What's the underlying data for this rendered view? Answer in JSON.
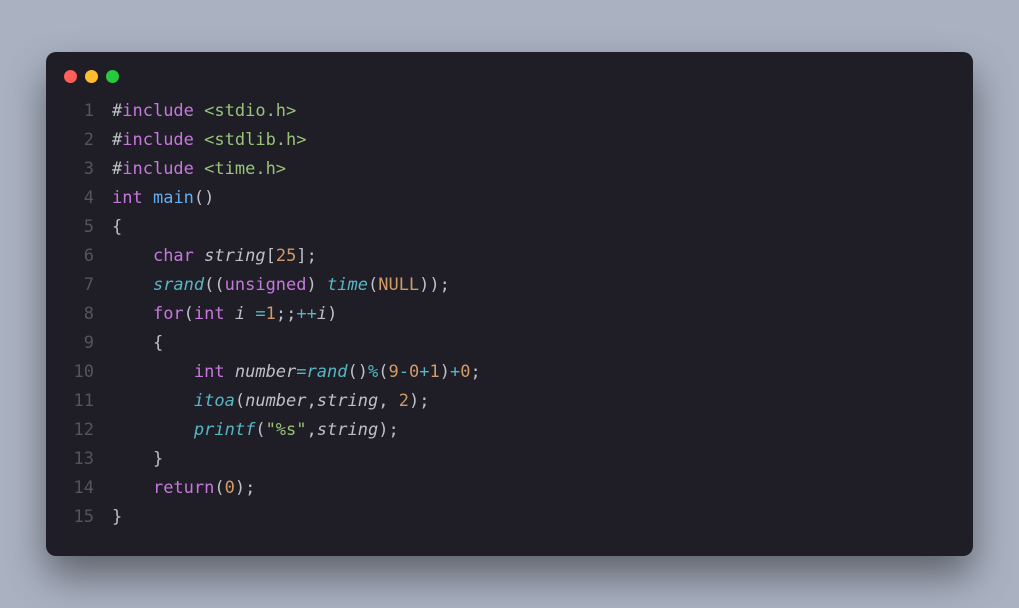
{
  "window": {
    "dots": [
      "red",
      "yellow",
      "green"
    ]
  },
  "code": {
    "gutter": [
      "1",
      "2",
      "3",
      "4",
      "5",
      "6",
      "7",
      "8",
      "9",
      "10",
      "11",
      "12",
      "13",
      "14",
      "15"
    ],
    "l1": {
      "hash": "#",
      "inc": "include",
      "path": "<stdio.h>"
    },
    "l2": {
      "hash": "#",
      "inc": "include",
      "path": "<stdlib.h>"
    },
    "l3": {
      "hash": "#",
      "inc": "include",
      "path": "<time.h>"
    },
    "l4": {
      "kw": "int",
      "sp": " ",
      "fn": "main",
      "par": "()"
    },
    "l5": {
      "brace": "{"
    },
    "l6": {
      "ind": "    ",
      "kw": "char",
      "sp": " ",
      "id": "string",
      "lb": "[",
      "n": "25",
      "rb": "]",
      "semi": ";"
    },
    "l7": {
      "ind": "    ",
      "fn": "srand",
      "lp": "((",
      "kw": "unsigned",
      "rp1": ")",
      "sp": " ",
      "fn2": "time",
      "lp2": "(",
      "null": "NULL",
      "rp2": "))",
      "semi": ";"
    },
    "l8": {
      "ind": "    ",
      "kw": "for",
      "lp": "(",
      "kw2": "int",
      "sp": " ",
      "id": "i",
      "sp2": " ",
      "eq": "=",
      "n": "1",
      "sc": ";;",
      "op": "++",
      "id2": "i",
      "rp": ")"
    },
    "l9": {
      "ind": "    ",
      "brace": "{"
    },
    "l10": {
      "ind": "        ",
      "kw": "int",
      "sp": " ",
      "id": "number",
      "eq": "=",
      "fn": "rand",
      "par": "()",
      "op1": "%",
      "lp": "(",
      "n9": "9",
      "m1": "-",
      "n0": "0",
      "p1": "+",
      "n1": "1",
      "rp": ")",
      "p2": "+",
      "n0b": "0",
      "semi": ";"
    },
    "l11": {
      "ind": "        ",
      "fn": "itoa",
      "lp": "(",
      "a1": "number",
      "c1": ",",
      "a2": "string",
      "c2": ",",
      "sp": " ",
      "n": "2",
      "rp": ")",
      "semi": ";"
    },
    "l12": {
      "ind": "        ",
      "fn": "printf",
      "lp": "(",
      "str": "\"%s\"",
      "c": ",",
      "a": "string",
      "rp": ")",
      "semi": ";"
    },
    "l13": {
      "ind": "    ",
      "brace": "}"
    },
    "l14": {
      "ind": "    ",
      "kw": "return",
      "lp": "(",
      "n": "0",
      "rp": ")",
      "semi": ";"
    },
    "l15": {
      "brace": "}"
    }
  }
}
